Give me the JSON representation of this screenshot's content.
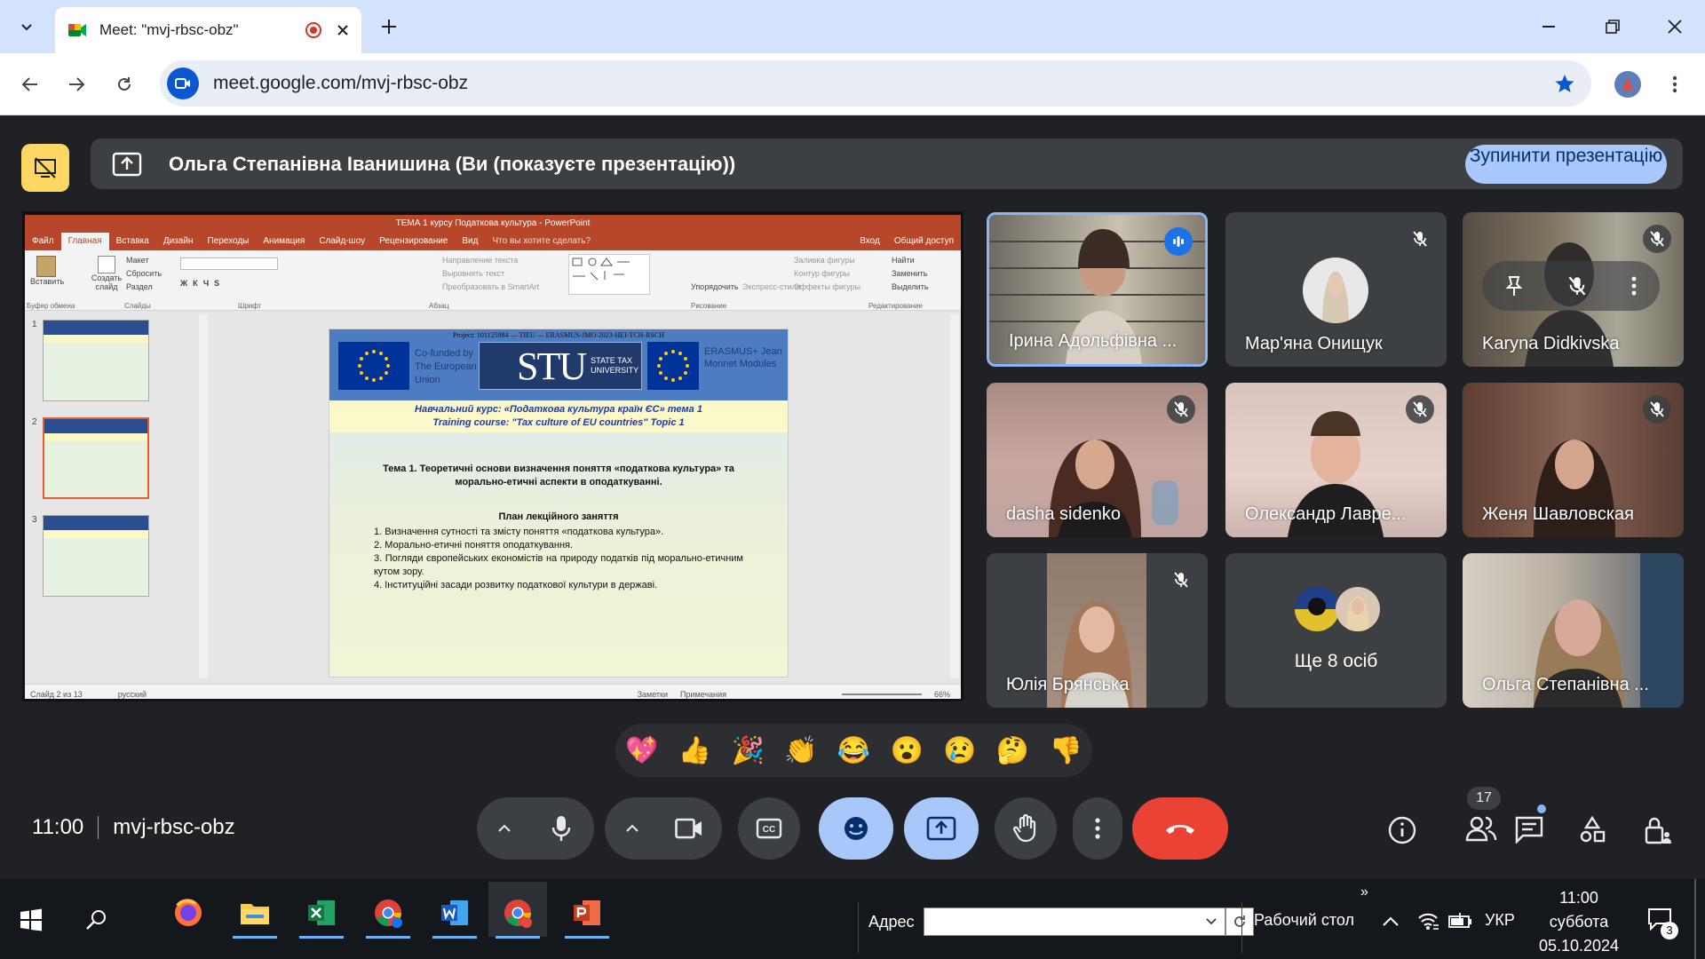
{
  "browser": {
    "tab_title": "Meet: \"mvj-rbsc-obz\"",
    "url": "meet.google.com/mvj-rbsc-obz"
  },
  "presenting_bar": {
    "text": "Ольга Степанівна Іванишина (Ви (показуєте презентацію))",
    "stop_button": "Зупинити презентацію"
  },
  "powerpoint": {
    "title": "ТЕМА 1 курсу Податкова культура - PowerPoint",
    "tabs": [
      "Файл",
      "Главная",
      "Вставка",
      "Дизайн",
      "Переходы",
      "Анимация",
      "Слайд-шоу",
      "Рецензирование",
      "Вид"
    ],
    "tell_me": "Что вы хотите сделать?",
    "signin": "Вход",
    "share": "Общий доступ",
    "ribbon": {
      "paste": "Вставить",
      "create_slide": "Создать слайд",
      "layout": "Макет",
      "reset": "Сбросить",
      "section": "Раздел",
      "text_direction": "Направление текста",
      "align_text": "Выровнять текст",
      "smartart": "Преобразовать в SmartArt",
      "arrange": "Упорядочить",
      "quick_styles": "Экспресс-стили",
      "fill": "Заливка фигуры",
      "outline": "Контур фигуры",
      "effects": "Эффекты фигуры",
      "find": "Найти",
      "replace": "Заменить",
      "select": "Выделить",
      "groups": [
        "Буфер обмена",
        "Слайды",
        "Шрифт",
        "Абзац",
        "Рисование",
        "Редактирование"
      ]
    },
    "thumbs": [
      "1",
      "2",
      "3"
    ],
    "status_left": "Слайд 2 из 13",
    "status_lang": "русский",
    "status_notes": "Заметки",
    "status_comments": "Примечания",
    "zoom": "66%"
  },
  "slide": {
    "project": "Project: 101125984 — TIEU — ERASMUS-JMO-2023-HEI-TCH-RSCH",
    "cofunded": "Co-funded by The European Union",
    "stu": "STU",
    "stu_sub": "STATE TAX UNIVERSITY",
    "erasmus": "ERASMUS+ Jean Monnet Modules",
    "course_ua": "Навчальний курс: «Податкова культура країн ЄС» тема 1",
    "course_en": "Training course: \"Tax culture of EU countries\" Topic 1",
    "topic": "Тема 1. Теоретичні основи визначення поняття «податкова культура» та морально-етичні аспекти в оподаткуванні.",
    "plan_title": "План лекційного заняття",
    "plan": [
      "1.   Визначення сутності та змісту поняття «податкова культура».",
      "2.   Морально-етичні поняття оподаткування.",
      "3.   Погляди європейських економістів на природу податків під морально-етичним кутом зору.",
      "4.   Інституційні засади розвитку податкової культури в державі."
    ]
  },
  "participants": [
    {
      "name": "Ірина Адольфівна ...",
      "speaking": true
    },
    {
      "name": "Мар'яна Онищук",
      "muted": true
    },
    {
      "name": "Karyna Didkivska",
      "muted": true
    },
    {
      "name": "dasha sidenko",
      "muted": true
    },
    {
      "name": "Олександр Лавре...",
      "muted": true
    },
    {
      "name": "Женя Шавловская",
      "muted": true
    },
    {
      "name": "Юлія Брянська",
      "muted": true
    },
    {
      "name": "Ще 8 осіб"
    },
    {
      "name": "Ольга Степанівна ..."
    }
  ],
  "reactions": [
    "💖",
    "👍",
    "🎉",
    "👏",
    "😂",
    "😮",
    "😢",
    "🤔",
    "👎"
  ],
  "footer": {
    "time": "11:00",
    "meeting_code": "mvj-rbsc-obz",
    "people_count": "17"
  },
  "taskbar": {
    "address_label": "Адрес",
    "desktop": "Рабочий стол",
    "lang": "УКР",
    "time": "11:00",
    "day": "суббота",
    "date": "05.10.2024",
    "notifications": "3"
  },
  "colors": {
    "meet_bg": "#202124",
    "tile_bg": "#3c4043",
    "accent_blue": "#a8c7fa",
    "end_call": "#ea4335",
    "ppt_red": "#b7472a"
  }
}
